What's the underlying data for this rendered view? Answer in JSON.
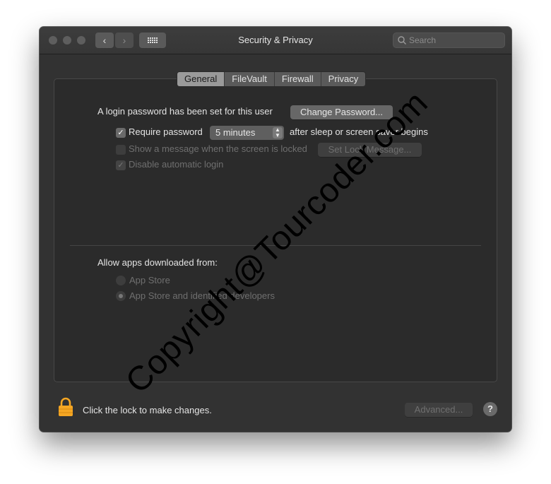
{
  "window": {
    "title": "Security & Privacy",
    "search_placeholder": "Search",
    "back_glyph": "‹",
    "forward_glyph": "›"
  },
  "tabs": [
    {
      "label": "General",
      "active": true
    },
    {
      "label": "FileVault",
      "active": false
    },
    {
      "label": "Firewall",
      "active": false
    },
    {
      "label": "Privacy",
      "active": false
    }
  ],
  "general": {
    "login_password_text": "A login password has been set for this user",
    "change_password_button": "Change Password...",
    "require_password": {
      "checked": true,
      "label": "Require password",
      "value": "5 minutes",
      "suffix": "after sleep or screen saver begins"
    },
    "show_message": {
      "checked": false,
      "enabled": false,
      "label": "Show a message when the screen is locked",
      "button": "Set Lock Message..."
    },
    "disable_auto_login": {
      "checked": true,
      "enabled": false,
      "label": "Disable automatic login"
    },
    "allow_apps_label": "Allow apps downloaded from:",
    "allow_options": [
      {
        "label": "App Store",
        "selected": false
      },
      {
        "label": "App Store and identified developers",
        "selected": true
      }
    ]
  },
  "footer": {
    "lock_text": "Click the lock to make changes.",
    "advanced_button": "Advanced...",
    "help_glyph": "?"
  },
  "watermark": "Copyright@Tourcoder.com",
  "colors": {
    "window_bg": "#323232",
    "panel_bg": "#2b2b2b",
    "lock_color": "#f5a623"
  }
}
